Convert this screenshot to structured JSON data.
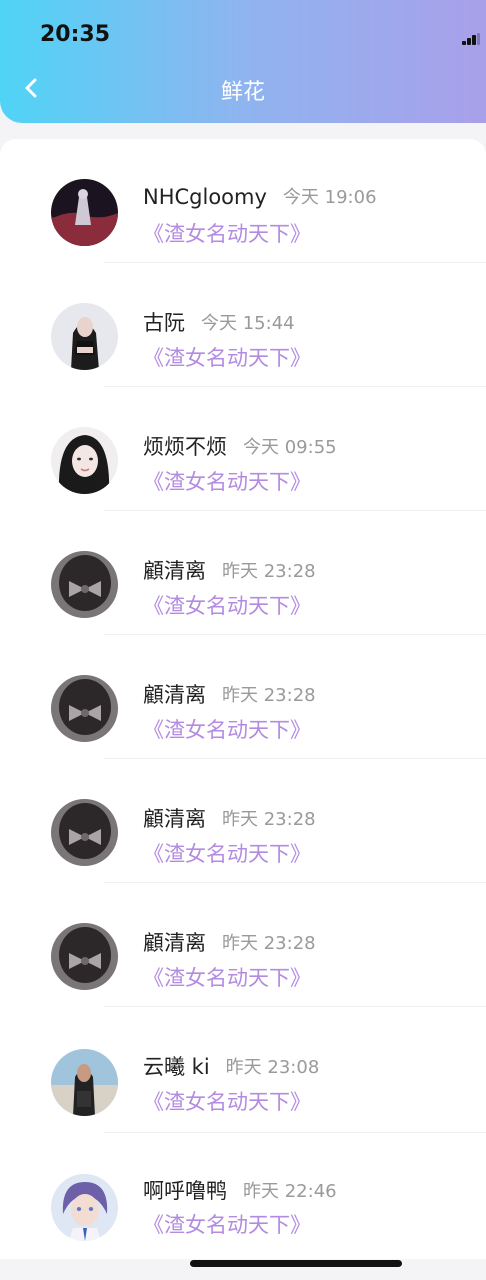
{
  "status_bar": {
    "time": "20:35"
  },
  "header": {
    "title": "鲜花",
    "back_icon": "chevron-left-icon"
  },
  "list": [
    {
      "name": "NHCgloomy",
      "time": "今天 19:06",
      "work": "《渣女名动天下》",
      "avatar": "dark-scene"
    },
    {
      "name": "古阮",
      "time": "今天 15:44",
      "work": "《渣女名动天下》",
      "avatar": "girl-black-hair"
    },
    {
      "name": "烦烦不烦",
      "time": "今天 09:55",
      "work": "《渣女名动天下》",
      "avatar": "girl-selfie"
    },
    {
      "name": "顧清离",
      "time": "昨天 23:28",
      "work": "《渣女名动天下》",
      "avatar": "hair-bow"
    },
    {
      "name": "顧清离",
      "time": "昨天 23:28",
      "work": "《渣女名动天下》",
      "avatar": "hair-bow"
    },
    {
      "name": "顧清离",
      "time": "昨天 23:28",
      "work": "《渣女名动天下》",
      "avatar": "hair-bow"
    },
    {
      "name": "顧清离",
      "time": "昨天 23:28",
      "work": "《渣女名动天下》",
      "avatar": "hair-bow"
    },
    {
      "name": "云曦 ki",
      "time": "昨天 23:08",
      "work": "《渣女名动天下》",
      "avatar": "girl-outdoor"
    },
    {
      "name": "啊呼噜鸭",
      "time": "昨天 22:46",
      "work": "《渣女名动天下》",
      "avatar": "anime-boy"
    }
  ],
  "colors": {
    "work_text": "#b38be0",
    "header_start": "#4fd4f6",
    "header_end": "#a9a0ea"
  }
}
